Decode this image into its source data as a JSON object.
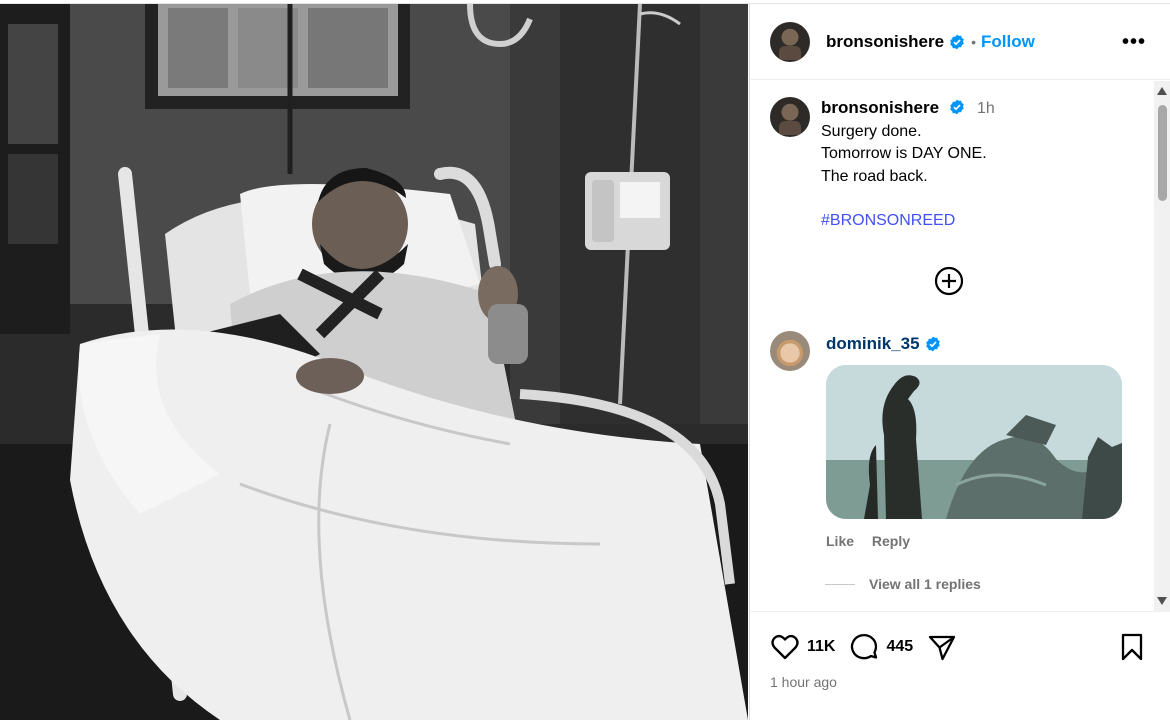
{
  "post": {
    "author": "bronsonishere",
    "follow_label": "Follow",
    "more_label": "•••",
    "dot": "•",
    "photo_icon": "hospital-bed-photo"
  },
  "caption": {
    "author": "bronsonishere",
    "time": "1h",
    "lines": [
      "Surgery done.",
      "Tomorrow is DAY ONE.",
      "The road back."
    ],
    "hashtag": "#BRONSONREED"
  },
  "load_more_icon": "plus-circle-icon",
  "comments": [
    {
      "author": "dominik_35",
      "gif_icon": "godzilla-gif",
      "like_label": "Like",
      "reply_label": "Reply",
      "view_replies_label": "View all 1 replies"
    }
  ],
  "actions": {
    "likes": "11K",
    "comments": "445",
    "posted": "1 hour ago"
  },
  "colors": {
    "link": "#0095f6",
    "hashtag": "#4150f7",
    "username_link": "#00376b",
    "muted": "#737373"
  }
}
